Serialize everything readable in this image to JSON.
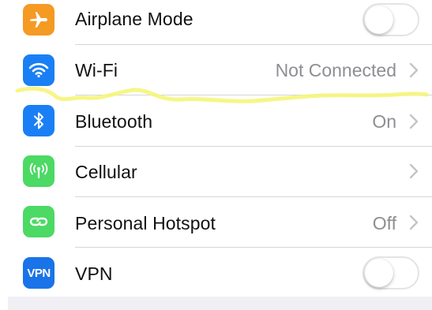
{
  "settings": {
    "rows": [
      {
        "label": "Airplane Mode",
        "control": "toggle",
        "toggle_on": false,
        "icon": "airplane-icon",
        "icon_color": "#f59a23"
      },
      {
        "label": "Wi-Fi",
        "value": "Not Connected",
        "control": "chevron",
        "icon": "wifi-icon",
        "icon_color": "#1a7ff5"
      },
      {
        "label": "Bluetooth",
        "value": "On",
        "control": "chevron",
        "icon": "bluetooth-icon",
        "icon_color": "#1a7ff5"
      },
      {
        "label": "Cellular",
        "value": "",
        "control": "chevron",
        "icon": "cellular-icon",
        "icon_color": "#4cd964"
      },
      {
        "label": "Personal Hotspot",
        "value": "Off",
        "control": "chevron",
        "icon": "hotspot-icon",
        "icon_color": "#4cd964"
      },
      {
        "label": "VPN",
        "control": "toggle",
        "toggle_on": false,
        "icon": "vpn-icon",
        "icon_color": "#1a73e8",
        "icon_text": "VPN"
      }
    ]
  },
  "annotation": {
    "type": "yellow highlighter stroke under Wi-Fi row",
    "color": "#f5f57a"
  }
}
